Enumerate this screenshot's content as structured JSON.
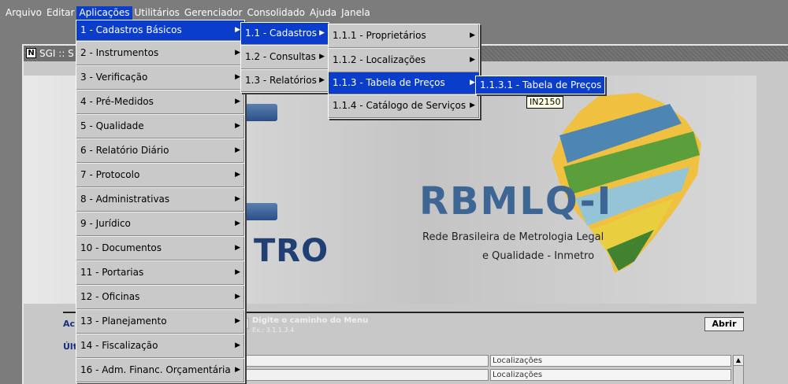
{
  "menubar": {
    "items": [
      "Arquivo",
      "Editar",
      "Aplicações",
      "Utilitários",
      "Gerenciador",
      "Consolidado",
      "Ajuda",
      "Janela"
    ],
    "active_index": 2
  },
  "window": {
    "title": "SGI :: S",
    "app_icon": "N"
  },
  "menus": {
    "aplicacoes": [
      "1 - Cadastros Básicos",
      "2 - Instrumentos",
      "3 - Verificação",
      "4 - Pré-Medidos",
      "5 - Qualidade",
      "6 - Relatório Diário",
      "7 - Protocolo",
      "8 - Administrativas",
      "9 - Jurídico",
      "10 - Documentos",
      "11 - Portarias",
      "12 - Oficinas",
      "13 - Planejamento",
      "14 - Fiscalização",
      "16 - Adm. Financ. Orçamentária"
    ],
    "cadastros_basicos": [
      "1.1 - Cadastros",
      "1.2 - Consultas",
      "1.3 - Relatórios"
    ],
    "cadastros": [
      "1.1.1 - Proprietários",
      "1.1.2 - Localizações",
      "1.1.3 - Tabela de Preços",
      "1.1.4 - Catálogo de Serviços"
    ],
    "tabela_precos": [
      "1.1.3.1 - Tabela de Preços"
    ]
  },
  "tooltip": "IN2150",
  "logo": {
    "left_text": "TRO",
    "name": "RBMLQ-I",
    "subtitle_line1": "Rede Brasileira de Metrologia Legal",
    "subtitle_line2": "e Qualidade - Inmetro"
  },
  "access": {
    "label": "Ac",
    "path_hint": "Digite o caminho do Menu",
    "path_example": "Ex.: 3.1.1.3.4",
    "open_button": "Abrir"
  },
  "recent": {
    "label": "Últ",
    "rows": [
      "Localizações",
      "Localizações"
    ]
  },
  "colors": {
    "highlight": "#0a3dc9",
    "menu_bg": "#c9c9c9",
    "desktop_bg": "#7c7c7c"
  }
}
